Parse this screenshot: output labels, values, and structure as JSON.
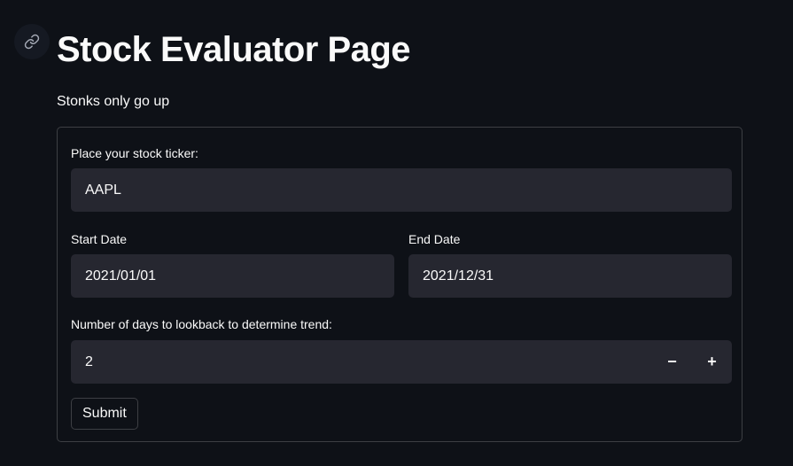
{
  "header": {
    "anchor_icon": "link-icon",
    "title": "Stock Evaluator Page",
    "subtitle": "Stonks only go up"
  },
  "form": {
    "ticker": {
      "label": "Place your stock ticker:",
      "value": "AAPL"
    },
    "start_date": {
      "label": "Start Date",
      "value": "2021/01/01"
    },
    "end_date": {
      "label": "End Date",
      "value": "2021/12/31"
    },
    "lookback": {
      "label": "Number of days to lookback to determine trend:",
      "value": "2",
      "decrement_label": "−",
      "increment_label": "+"
    },
    "submit_label": "Submit"
  },
  "colors": {
    "background": "#0e1117",
    "input_background": "#262730",
    "text": "#fafafa",
    "border": "rgba(250,250,250,0.2)"
  }
}
